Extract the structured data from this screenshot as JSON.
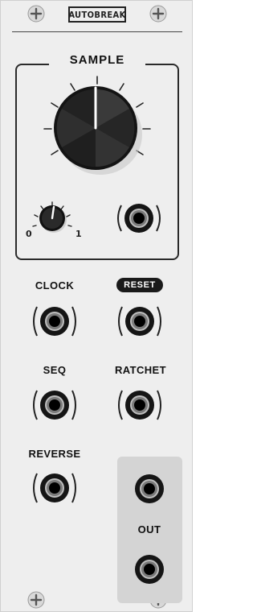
{
  "module": {
    "title": "AUTOBREAK"
  },
  "sample_section": {
    "title": "SAMPLE",
    "knob_value": 0.5,
    "attenuverter": {
      "min_label": "0",
      "max_label": "1",
      "value": 0.55
    }
  },
  "inputs": {
    "clock_label": "CLOCK",
    "reset_label": "RESET",
    "seq_label": "SEQ",
    "ratchet_label": "RATCHET",
    "reverse_label": "REVERSE"
  },
  "output": {
    "label": "OUT"
  },
  "colors": {
    "panel": "#eeeeee",
    "outline": "#2a2a2a",
    "output_bg": "#d4d4d4",
    "reset_bg": "#1a1a1a"
  }
}
